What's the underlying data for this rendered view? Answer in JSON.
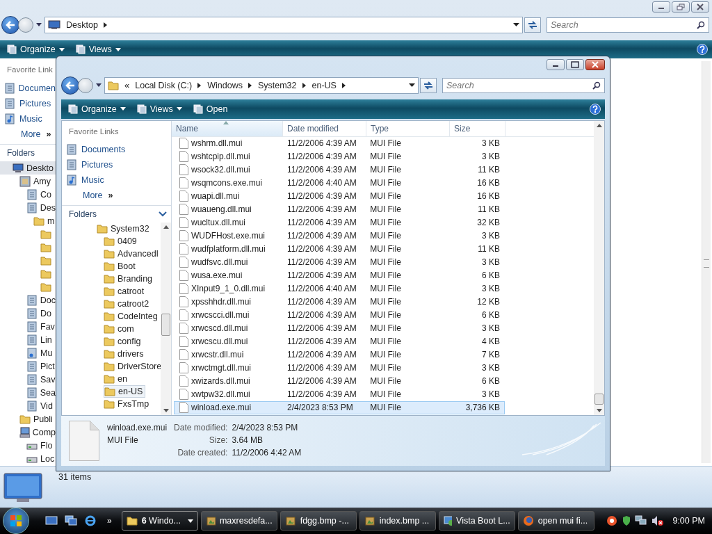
{
  "background_window": {
    "address": {
      "crumbs": [
        "Desktop"
      ]
    },
    "search": {
      "placeholder": "Search"
    },
    "toolbar": [
      {
        "label": "Organize"
      },
      {
        "label": "Views"
      }
    ],
    "favorite_links": {
      "title": "Favorite Link",
      "items": [
        {
          "label": "Documen",
          "kind": "special"
        },
        {
          "label": "Pictures",
          "kind": "special"
        },
        {
          "label": "Music",
          "kind": "music"
        }
      ],
      "more": "More",
      "more_glyph": "»"
    },
    "folders_title": "Folders",
    "tree": [
      {
        "label": "Deskto",
        "kind": "desktop",
        "selected": true,
        "children": [
          {
            "label": "Amy",
            "kind": "user",
            "selected": false,
            "children": [
              {
                "label": "Co",
                "kind": "special",
                "selected": false
              },
              {
                "label": "Des",
                "kind": "special",
                "selected": false,
                "children": [
                  {
                    "label": "m",
                    "kind": "folder",
                    "selected": false,
                    "children": [
                      {
                        "kind": "folder",
                        "selected": false
                      },
                      {
                        "kind": "folder",
                        "selected": false
                      },
                      {
                        "kind": "folder",
                        "selected": false
                      },
                      {
                        "kind": "folder",
                        "selected": false
                      },
                      {
                        "kind": "folder",
                        "selected": false
                      }
                    ]
                  }
                ]
              },
              {
                "label": "Doc",
                "kind": "special",
                "selected": false
              },
              {
                "label": "Do",
                "kind": "special",
                "selected": false
              },
              {
                "label": "Fav",
                "kind": "special",
                "selected": false
              },
              {
                "label": "Lin",
                "kind": "special",
                "selected": false
              },
              {
                "label": "Mu",
                "kind": "music",
                "selected": false
              },
              {
                "label": "Pict",
                "kind": "special",
                "selected": false
              },
              {
                "label": "Sav",
                "kind": "special",
                "selected": false
              },
              {
                "label": "Sea",
                "kind": "special",
                "selected": false
              },
              {
                "label": "Vid",
                "kind": "special",
                "selected": false
              }
            ]
          },
          {
            "label": "Publi",
            "kind": "folder",
            "selected": false
          },
          {
            "label": "Comp",
            "kind": "computer",
            "selected": false,
            "children": [
              {
                "label": "Flo",
                "kind": "drive",
                "selected": false
              },
              {
                "label": "Loc",
                "kind": "drive",
                "selected": false
              }
            ]
          }
        ]
      }
    ],
    "status": "31 items"
  },
  "front_window": {
    "address": {
      "lead": "«",
      "crumbs": [
        "Local Disk (C:)",
        "Windows",
        "System32",
        "en-US"
      ]
    },
    "search": {
      "placeholder": "Search"
    },
    "toolbar": [
      {
        "label": "Organize",
        "kind": "menu"
      },
      {
        "label": "Views",
        "kind": "menu"
      },
      {
        "label": "Open",
        "kind": "plain"
      }
    ],
    "favorite_links": {
      "title": "Favorite Links",
      "items": [
        {
          "label": "Documents",
          "kind": "special"
        },
        {
          "label": "Pictures",
          "kind": "special"
        },
        {
          "label": "Music",
          "kind": "music"
        }
      ],
      "more": "More",
      "more_glyph": "»"
    },
    "folders_title": "Folders",
    "tree": [
      {
        "label": "System32",
        "kind": "folder",
        "selected": false,
        "children": [
          {
            "label": "0409",
            "kind": "folder",
            "selected": false
          },
          {
            "label": "AdvancedI",
            "kind": "folder",
            "selected": false
          },
          {
            "label": "Boot",
            "kind": "folder",
            "selected": false
          },
          {
            "label": "Branding",
            "kind": "folder",
            "selected": false
          },
          {
            "label": "catroot",
            "kind": "folder",
            "selected": false
          },
          {
            "label": "catroot2",
            "kind": "folder",
            "selected": false
          },
          {
            "label": "CodeInteg",
            "kind": "folder",
            "selected": false
          },
          {
            "label": "com",
            "kind": "folder",
            "selected": false
          },
          {
            "label": "config",
            "kind": "folder",
            "selected": false
          },
          {
            "label": "drivers",
            "kind": "folder",
            "selected": false
          },
          {
            "label": "DriverStore",
            "kind": "folder",
            "selected": false
          },
          {
            "label": "en",
            "kind": "folder",
            "selected": false
          },
          {
            "label": "en-US",
            "kind": "folder",
            "selected": true
          },
          {
            "label": "FxsTmp",
            "kind": "folder",
            "selected": false
          }
        ]
      }
    ],
    "columns": [
      {
        "label": "Name",
        "sorted": true
      },
      {
        "label": "Date modified",
        "sorted": false
      },
      {
        "label": "Type",
        "sorted": false
      },
      {
        "label": "Size",
        "sorted": false
      }
    ],
    "rows": [
      {
        "name": "wshrm.dll.mui",
        "date": "11/2/2006 4:39 AM",
        "type": "MUI File",
        "size": "3 KB",
        "selected": false
      },
      {
        "name": "wshtcpip.dll.mui",
        "date": "11/2/2006 4:39 AM",
        "type": "MUI File",
        "size": "3 KB",
        "selected": false
      },
      {
        "name": "wsock32.dll.mui",
        "date": "11/2/2006 4:39 AM",
        "type": "MUI File",
        "size": "11 KB",
        "selected": false
      },
      {
        "name": "wsqmcons.exe.mui",
        "date": "11/2/2006 4:40 AM",
        "type": "MUI File",
        "size": "16 KB",
        "selected": false
      },
      {
        "name": "wuapi.dll.mui",
        "date": "11/2/2006 4:39 AM",
        "type": "MUI File",
        "size": "16 KB",
        "selected": false
      },
      {
        "name": "wuaueng.dll.mui",
        "date": "11/2/2006 4:39 AM",
        "type": "MUI File",
        "size": "11 KB",
        "selected": false
      },
      {
        "name": "wucltux.dll.mui",
        "date": "11/2/2006 4:39 AM",
        "type": "MUI File",
        "size": "32 KB",
        "selected": false
      },
      {
        "name": "WUDFHost.exe.mui",
        "date": "11/2/2006 4:39 AM",
        "type": "MUI File",
        "size": "3 KB",
        "selected": false
      },
      {
        "name": "wudfplatform.dll.mui",
        "date": "11/2/2006 4:39 AM",
        "type": "MUI File",
        "size": "11 KB",
        "selected": false
      },
      {
        "name": "wudfsvc.dll.mui",
        "date": "11/2/2006 4:39 AM",
        "type": "MUI File",
        "size": "3 KB",
        "selected": false
      },
      {
        "name": "wusa.exe.mui",
        "date": "11/2/2006 4:39 AM",
        "type": "MUI File",
        "size": "6 KB",
        "selected": false
      },
      {
        "name": "XInput9_1_0.dll.mui",
        "date": "11/2/2006 4:40 AM",
        "type": "MUI File",
        "size": "3 KB",
        "selected": false
      },
      {
        "name": "xpsshhdr.dll.mui",
        "date": "11/2/2006 4:39 AM",
        "type": "MUI File",
        "size": "12 KB",
        "selected": false
      },
      {
        "name": "xrwcscci.dll.mui",
        "date": "11/2/2006 4:39 AM",
        "type": "MUI File",
        "size": "6 KB",
        "selected": false
      },
      {
        "name": "xrwcscd.dll.mui",
        "date": "11/2/2006 4:39 AM",
        "type": "MUI File",
        "size": "3 KB",
        "selected": false
      },
      {
        "name": "xrwcscu.dll.mui",
        "date": "11/2/2006 4:39 AM",
        "type": "MUI File",
        "size": "4 KB",
        "selected": false
      },
      {
        "name": "xrwcstr.dll.mui",
        "date": "11/2/2006 4:39 AM",
        "type": "MUI File",
        "size": "7 KB",
        "selected": false
      },
      {
        "name": "xrwctmgt.dll.mui",
        "date": "11/2/2006 4:39 AM",
        "type": "MUI File",
        "size": "3 KB",
        "selected": false
      },
      {
        "name": "xwizards.dll.mui",
        "date": "11/2/2006 4:39 AM",
        "type": "MUI File",
        "size": "6 KB",
        "selected": false
      },
      {
        "name": "xwtpw32.dll.mui",
        "date": "11/2/2006 4:39 AM",
        "type": "MUI File",
        "size": "3 KB",
        "selected": false
      },
      {
        "name": "winload.exe.mui",
        "date": "2/4/2023 8:53 PM",
        "type": "MUI File",
        "size": "3,736 KB",
        "selected": true
      }
    ],
    "details": {
      "name": "winload.exe.mui",
      "type": "MUI File",
      "fields": [
        {
          "label": "Date modified:",
          "value": "2/4/2023 8:53 PM"
        },
        {
          "label": "Size:",
          "value": "3.64 MB"
        },
        {
          "label": "Date created:",
          "value": "11/2/2006 4:42 AM"
        }
      ]
    }
  },
  "taskbar": {
    "quick_launch_more": "»",
    "tasks": [
      {
        "label": "**6** Windo...",
        "kind": "folder",
        "grouped": true,
        "selected": true
      },
      {
        "label": "maxresdefa...",
        "kind": "image",
        "grouped": false,
        "selected": false
      },
      {
        "label": "fdgg.bmp -...",
        "kind": "image",
        "grouped": false,
        "selected": false
      },
      {
        "label": "index.bmp ...",
        "kind": "image",
        "grouped": false,
        "selected": false
      },
      {
        "label": "Vista Boot L...",
        "kind": "app",
        "grouped": false,
        "selected": false
      },
      {
        "label": "open mui fi...",
        "kind": "browser",
        "grouped": false,
        "selected": false
      }
    ],
    "clock": "9:00 PM"
  }
}
